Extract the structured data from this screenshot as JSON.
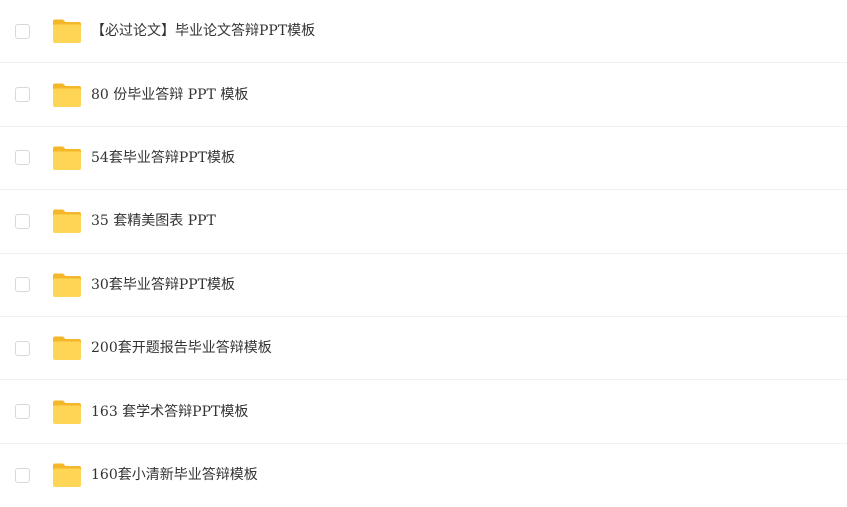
{
  "files": [
    {
      "name": "【必过论文】毕业论文答辩PPT模板",
      "icon": "folder-icon"
    },
    {
      "name": "80 份毕业答辩 PPT 模板",
      "icon": "folder-icon"
    },
    {
      "name": "54套毕业答辩PPT模板",
      "icon": "folder-icon"
    },
    {
      "name": "35 套精美图表 PPT",
      "icon": "folder-icon"
    },
    {
      "name": "30套毕业答辩PPT模板",
      "icon": "folder-icon"
    },
    {
      "name": "200套开题报告毕业答辩模板",
      "icon": "folder-icon"
    },
    {
      "name": "163 套学术答辩PPT模板",
      "icon": "folder-icon"
    },
    {
      "name": "160套小清新毕业答辩模板",
      "icon": "folder-icon"
    }
  ],
  "colors": {
    "folder_back": "#F5B72A",
    "folder_front": "#FFD556",
    "divider": "#F1F1F1",
    "checkbox_border": "#D9D9D9",
    "text": "#333333"
  }
}
